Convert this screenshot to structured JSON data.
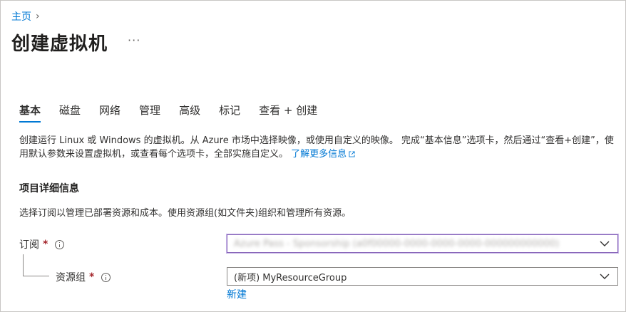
{
  "breadcrumb": {
    "home": "主页",
    "separator": "›"
  },
  "header": {
    "title": "创建虚拟机",
    "more": "···"
  },
  "tabs": [
    {
      "label": "基本",
      "active": true
    },
    {
      "label": "磁盘"
    },
    {
      "label": "网络"
    },
    {
      "label": "管理"
    },
    {
      "label": "高级"
    },
    {
      "label": "标记"
    },
    {
      "label": "查看 + 创建"
    }
  ],
  "intro": {
    "text": "创建运行 Linux 或 Windows 的虚拟机。从 Azure 市场中选择映像，或使用自定义的映像。 完成“基本信息”选项卡，然后通过“查看+创建”，使用默认参数来设置虚拟机，或查看每个选项卡，全部实施自定义。",
    "link": "了解更多信息"
  },
  "project_details": {
    "title": "项目详细信息",
    "description": "选择订阅以管理已部署资源和成本。使用资源组(如文件夹)组织和管理所有资源。",
    "subscription": {
      "label": "订阅",
      "required_mark": "*",
      "value": "Azure Pass - Sponsorship (a0f00000-0000-0000-0000-000000000000)"
    },
    "resource_group": {
      "label": "资源组",
      "required_mark": "*",
      "value": "(新项) MyResourceGroup",
      "create_new": "新建"
    }
  },
  "colors": {
    "accent": "#0078d4",
    "required": "#a4262c",
    "focus_border": "#8764b8"
  }
}
